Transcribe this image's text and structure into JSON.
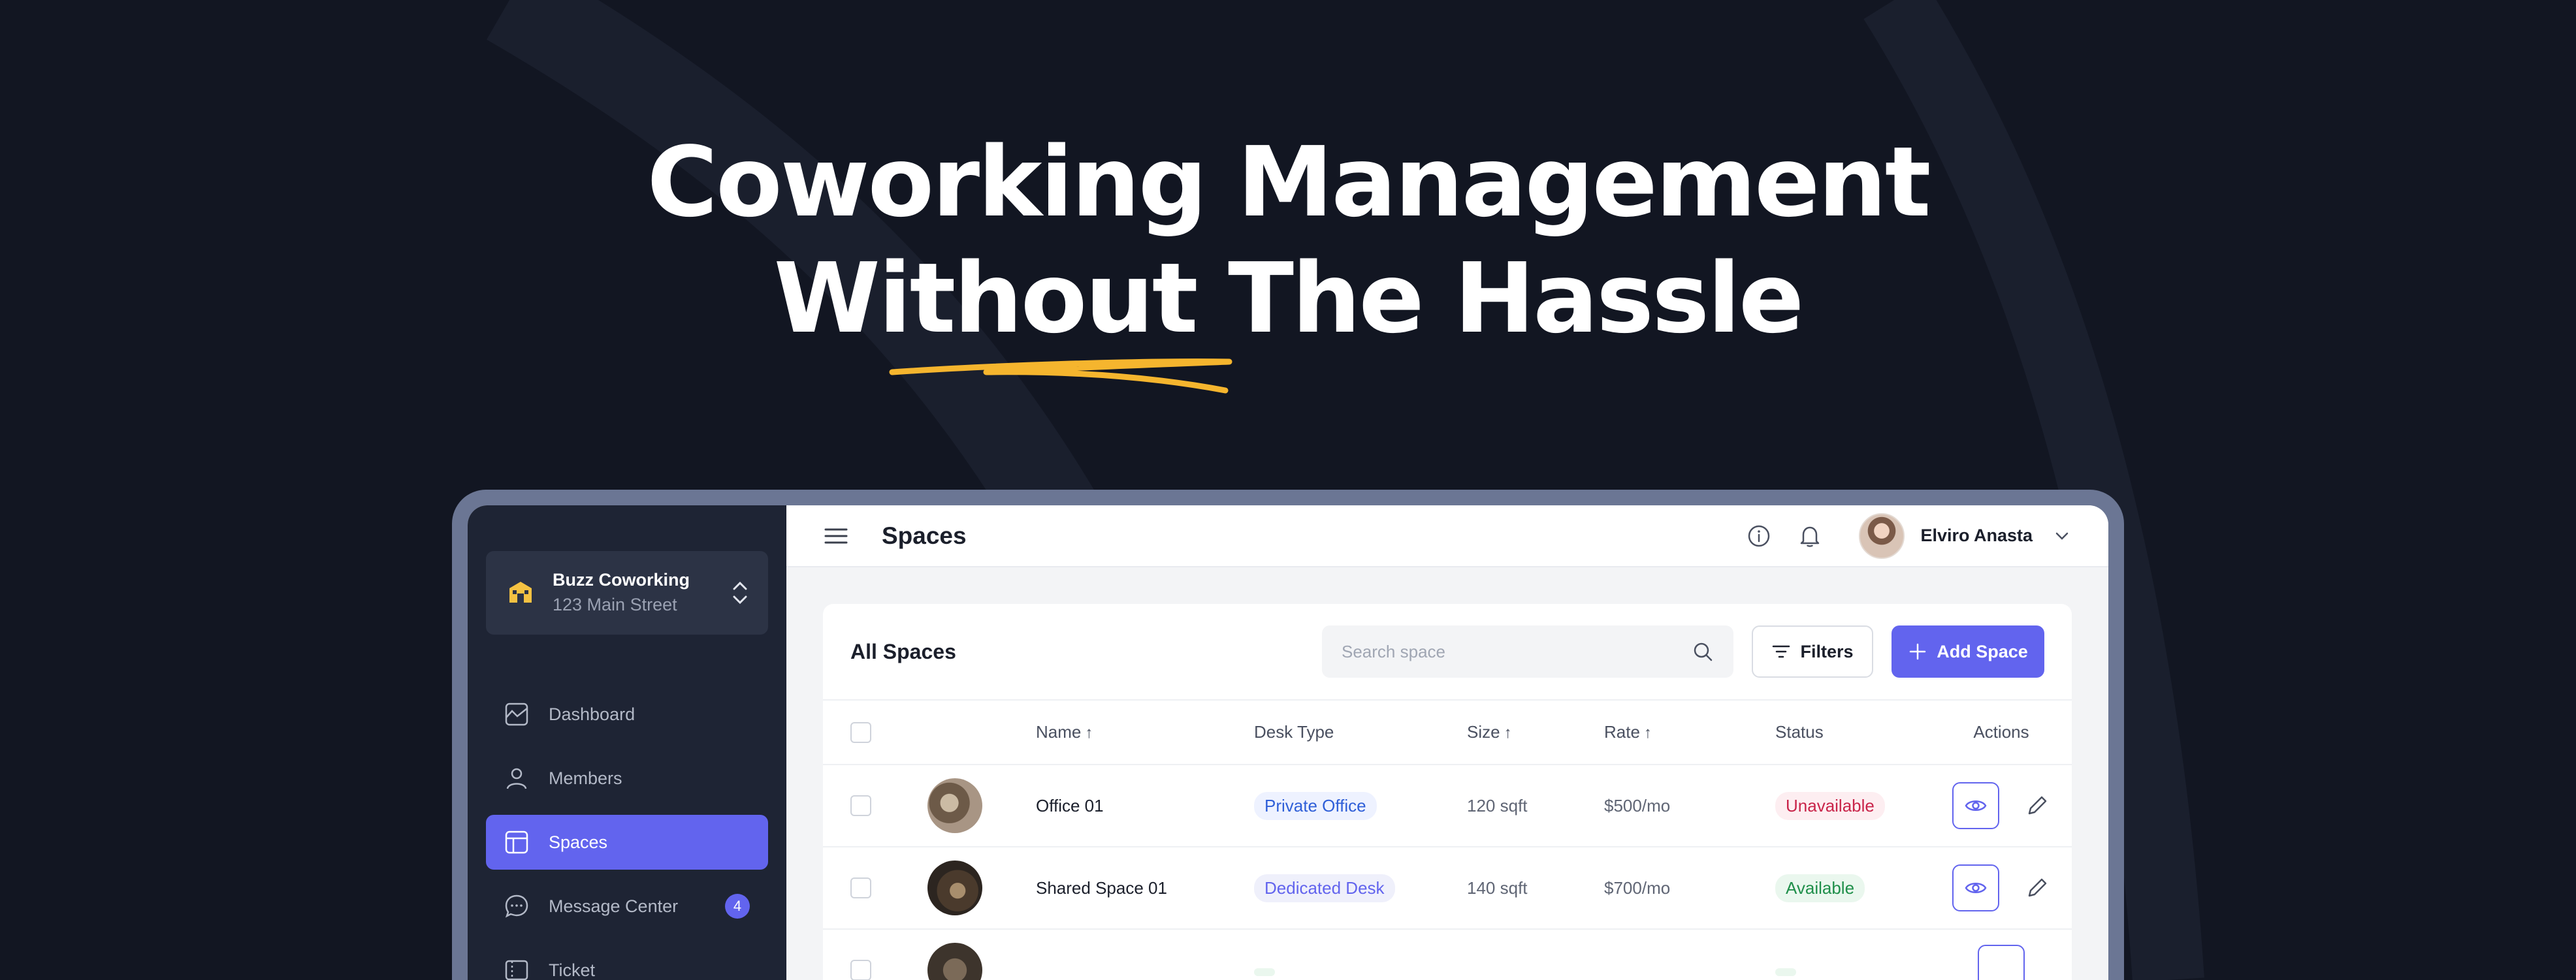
{
  "hero": {
    "line1": "Coworking Management",
    "line2": "Without The Hassle"
  },
  "colors": {
    "background": "#121622",
    "accent": "#6264ee",
    "underline": "#f5b52e",
    "device_frame": "#6b7694",
    "sidebar": "#1e2434"
  },
  "org": {
    "name": "Buzz Coworking",
    "address": "123 Main Street",
    "icon": "building-logo-icon"
  },
  "sidebar": {
    "items": [
      {
        "label": "Dashboard",
        "icon": "chart-icon",
        "active": false
      },
      {
        "label": "Members",
        "icon": "user-icon",
        "active": false
      },
      {
        "label": "Spaces",
        "icon": "layout-icon",
        "active": true
      },
      {
        "label": "Message Center",
        "icon": "chat-icon",
        "active": false,
        "badge": "4"
      },
      {
        "label": "Ticket",
        "icon": "ticket-icon",
        "active": false
      }
    ]
  },
  "header": {
    "title": "Spaces",
    "user_name": "Elviro Anasta"
  },
  "card": {
    "title": "All Spaces",
    "search_placeholder": "Search space",
    "filters_label": "Filters",
    "add_label": "Add Space"
  },
  "table": {
    "columns": {
      "name": "Name",
      "desk_type": "Desk Type",
      "size": "Size",
      "rate": "Rate",
      "status": "Status",
      "actions": "Actions"
    },
    "rows": [
      {
        "name": "Office 01",
        "desk_type": "Private Office",
        "size": "120 sqft",
        "rate": "$500/mo",
        "status": "Unavailable"
      },
      {
        "name": "Shared Space 01",
        "desk_type": "Dedicated Desk",
        "size": "140 sqft",
        "rate": "$700/mo",
        "status": "Available"
      },
      {
        "name": "",
        "desk_type": "",
        "size": "",
        "rate": "",
        "status": ""
      }
    ]
  }
}
